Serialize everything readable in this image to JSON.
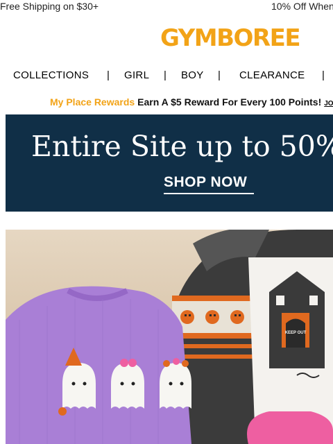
{
  "promo": {
    "left_text": "Free Shipping on $30+",
    "right_text": "10% Off When"
  },
  "brand": {
    "logo_text": "GYMBOREE",
    "logo_color": "#f2a317"
  },
  "nav": {
    "items": [
      {
        "label": "COLLECTIONS"
      },
      {
        "label": "GIRL"
      },
      {
        "label": "BOY"
      },
      {
        "label": "CLEARANCE"
      }
    ],
    "separator": "|"
  },
  "rewards": {
    "program": "My Place Rewards",
    "offer": "Earn A $5 Reward For Every 100 Points!",
    "join": "JO"
  },
  "hero": {
    "headline": "Entire Site up to 50%",
    "cta": "SHOP NOW",
    "background": "#102f47"
  },
  "photo": {
    "sign_text": "KEEP OUT"
  }
}
